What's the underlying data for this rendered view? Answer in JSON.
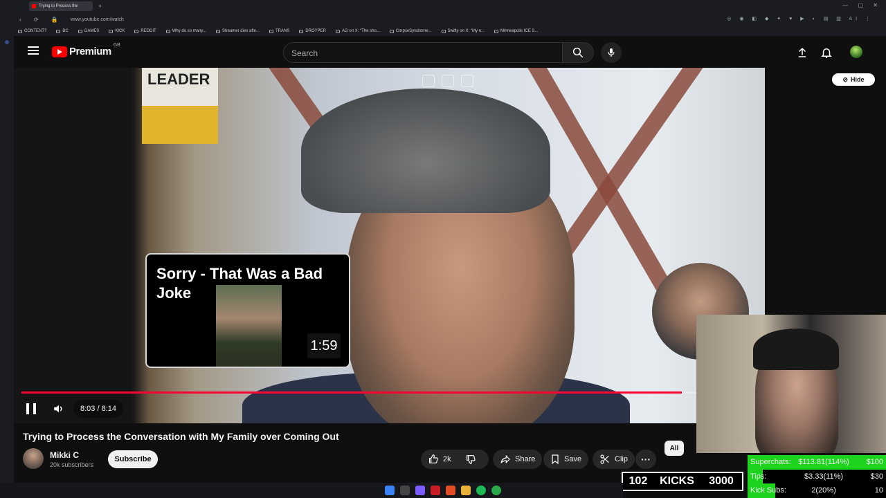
{
  "browser": {
    "tab_title": "Trying to Process the",
    "new_tab": "+",
    "url": "www.youtube.com/watch",
    "bookmarks": [
      "CONTENT?",
      "BC",
      "GAMES",
      "KICK",
      "REDDIT",
      "Why do so many...",
      "Streamer dies afte...",
      "TRANS",
      "DROYPER",
      "AG on X: \"The sho...",
      "CorpseSyndrome...",
      "Swifty on X: \"My n...",
      "Minneapolis ICE S..."
    ]
  },
  "header": {
    "logo_text": "Premium",
    "country_code": "GB",
    "search_placeholder": "Search"
  },
  "player": {
    "hide_label": "Hide",
    "time_display": "8:03 / 8:14",
    "progress_fraction": 0.978,
    "badge_text": "LEADER"
  },
  "endcard": {
    "title": "Sorry - That Was a Bad Joke",
    "duration": "1:59"
  },
  "video": {
    "title": "Trying to Process the Conversation with My Family over Coming Out",
    "channel_name": "Mikki C",
    "subscribers": "20k subscribers",
    "subscribe_label": "Subscribe",
    "likes": "2k",
    "share_label": "Share",
    "save_label": "Save",
    "clip_label": "Clip",
    "chip_all": "All"
  },
  "overlay": {
    "kicks_count": "102",
    "kicks_label": "KICKS",
    "kicks_goal": "3000",
    "stats": [
      {
        "label": "Superchats:",
        "value": "$113.81(114%)",
        "goal": "$100",
        "fraction": 1.0
      },
      {
        "label": "Tips:",
        "value": "$3.33(11%)",
        "goal": "$30",
        "fraction": 0.11
      },
      {
        "label": "Kick Subs:",
        "value": "2(20%)",
        "goal": "10",
        "fraction": 0.2
      }
    ]
  },
  "colors": {
    "accent_red": "#ff0000",
    "progress_red": "#ff0033",
    "goal_green": "#1dd31d"
  }
}
